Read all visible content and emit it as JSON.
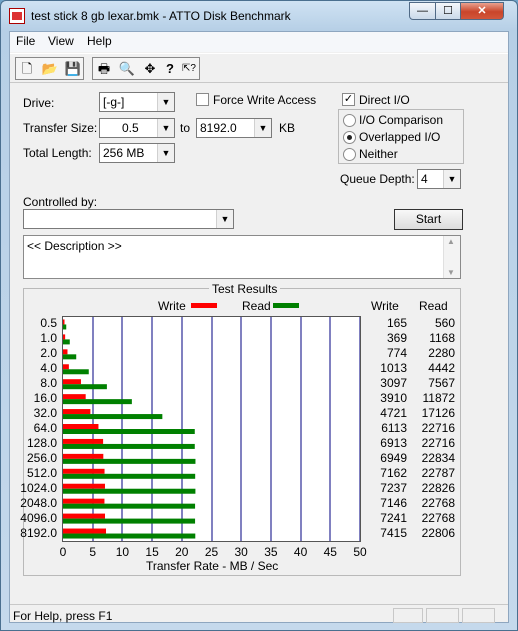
{
  "window": {
    "title": "test stick 8 gb lexar.bmk - ATTO Disk Benchmark",
    "min": "—",
    "max": "☐",
    "close": "✕"
  },
  "menu": [
    "File",
    "View",
    "Help"
  ],
  "toolbar": [
    "new-icon",
    "open-icon",
    "save-icon",
    "print-icon",
    "print-preview-icon",
    "move-icon",
    "help-icon",
    "context-help-icon"
  ],
  "toolbar_glyphs": [
    "🗋",
    "📂",
    "💾",
    "🖶",
    "🔍",
    "✥",
    "?",
    "⇱?"
  ],
  "form": {
    "drive_label": "Drive:",
    "drive_value": "[-g-]",
    "force_write_label": "Force Write Access",
    "force_write_checked": false,
    "direct_io_label": "Direct I/O",
    "direct_io_checked": true,
    "transfer_size_label": "Transfer Size:",
    "transfer_from": "0.5",
    "to_label": "to",
    "transfer_to": "8192.0",
    "kb_label": "KB",
    "total_length_label": "Total Length:",
    "total_length_value": "256 MB",
    "io_comparison_label": "I/O Comparison",
    "overlapped_io_label": "Overlapped I/O",
    "neither_label": "Neither",
    "selected_mode": "Overlapped I/O",
    "queue_depth_label": "Queue Depth:",
    "queue_depth_value": "4",
    "controlled_by_label": "Controlled by:",
    "controlled_by_value": "",
    "start_label": "Start",
    "description_text": "<< Description >>"
  },
  "results": {
    "title": "Test Results",
    "write_legend": "Write",
    "read_legend": "Read",
    "write_col": "Write",
    "read_col": "Read",
    "colors": {
      "write": "#ff0000",
      "read": "#008000",
      "grid": "#000080"
    }
  },
  "chart_data": {
    "type": "bar",
    "orientation": "horizontal",
    "categories": [
      "0.5",
      "1.0",
      "2.0",
      "4.0",
      "8.0",
      "16.0",
      "32.0",
      "64.0",
      "128.0",
      "256.0",
      "512.0",
      "1024.0",
      "2048.0",
      "4096.0",
      "8192.0"
    ],
    "series": [
      {
        "name": "Write",
        "values": [
          165,
          369,
          774,
          1013,
          3097,
          3910,
          4721,
          6113,
          6913,
          6949,
          7162,
          7237,
          7146,
          7241,
          7415
        ]
      },
      {
        "name": "Read",
        "values": [
          560,
          1168,
          2280,
          4442,
          7567,
          11872,
          17126,
          22716,
          22716,
          22834,
          22787,
          22826,
          22768,
          22768,
          22806
        ]
      }
    ],
    "xticks": [
      "0",
      "5",
      "10",
      "15",
      "20",
      "25",
      "30",
      "35",
      "40",
      "45",
      "50"
    ],
    "xlabel": "Transfer Rate - MB / Sec",
    "xlim": [
      0,
      50
    ]
  },
  "status": {
    "text": "For Help, press F1"
  }
}
